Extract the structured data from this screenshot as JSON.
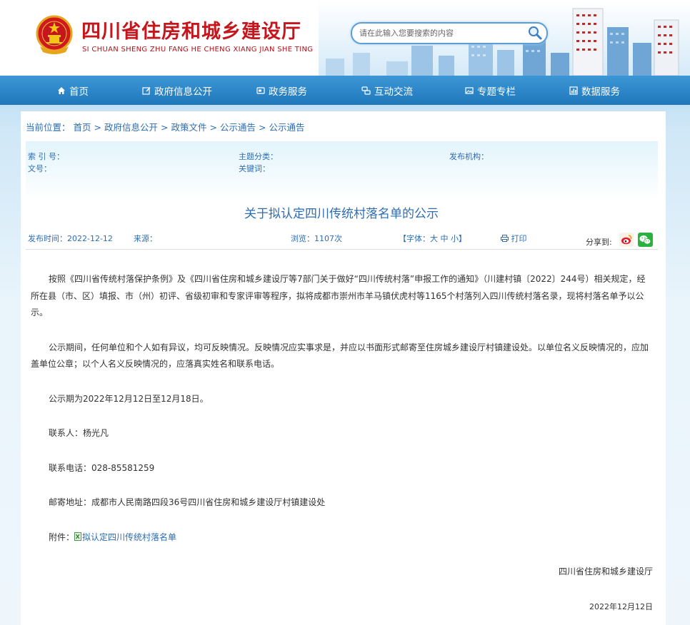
{
  "header": {
    "title": "四川省住房和城乡建设厅",
    "subtitle": "SI CHUAN SHENG ZHU FANG HE CHENG XIANG JIAN SHE TING",
    "search_placeholder": "请在此输入您要搜索的内容"
  },
  "nav": [
    {
      "label": "首页",
      "icon": "home-icon"
    },
    {
      "label": "政府信息公开",
      "icon": "edit-icon"
    },
    {
      "label": "政务服务",
      "icon": "service-icon"
    },
    {
      "label": "互动交流",
      "icon": "interaction-icon"
    },
    {
      "label": "专题专栏",
      "icon": "image-icon"
    },
    {
      "label": "数据服务",
      "icon": "chart-icon"
    }
  ],
  "breadcrumb": {
    "prefix": "当前位置：",
    "items": [
      "首页",
      "政府信息公开",
      "政策文件",
      "公示通告",
      "公示通告"
    ],
    "separator": ">"
  },
  "meta": {
    "index_label": "索 引 号：",
    "topic_label": "主题分类：",
    "publisher_label": "发布机构：",
    "docno_label": "文号：",
    "keywords_label": "关键词："
  },
  "article": {
    "title": "关于拟认定四川传统村落名单的公示",
    "publish_time": "发布时间：2022-12-12",
    "source": "来源：",
    "views": "浏览：1107次",
    "font_size_prefix": "【字体：",
    "font_large": "大",
    "font_medium": "中",
    "font_small": "小",
    "font_size_suffix": "】",
    "print": "打印",
    "share_label": "分享到:",
    "paragraphs": [
      "按照《四川省传统村落保护条例》及《四川省住房和城乡建设厅等7部门关于做好“四川传统村落”申报工作的通知》（川建村镇〔2022〕244号）相关规定，经所在县（市、区）填报、市（州）初评、省级初审和专家评审等程序，拟将成都市崇州市羊马镇伏虎村等1165个村落列入四川传统村落名录，现将村落名单予以公示。",
      "公示期间，任何单位和个人如有异议，均可反映情况。反映情况应实事求是，并应以书面形式邮寄至住房城乡建设厅村镇建设处。以单位名义反映情况的，应加盖单位公章；以个人名义反映情况的，应落真实姓名和联系电话。",
      "公示期为2022年12月12日至12月18日。",
      "联系人：杨光凡",
      "联系电话：028-85581259",
      "邮寄地址：成都市人民南路四段36号四川省住房和城乡建设厅村镇建设处"
    ],
    "attachment_label": "附件：",
    "attachment_name": "拟认定四川传统村落名单",
    "signature": "四川省住房和城乡建设厅",
    "date": "2022年12月12日"
  },
  "colors": {
    "brand_red": "#c4161c",
    "link_blue": "#2d6db3",
    "nav_blue": "#2a86c9"
  }
}
